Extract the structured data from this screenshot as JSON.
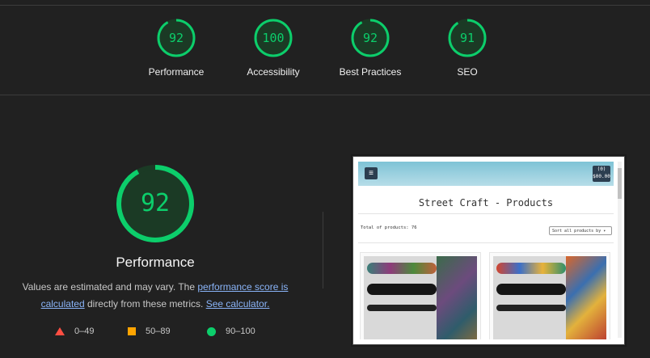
{
  "summary": [
    {
      "score": "92",
      "label": "Performance",
      "value": 92
    },
    {
      "score": "100",
      "label": "Accessibility",
      "value": 100
    },
    {
      "score": "92",
      "label": "Best Practices",
      "value": 92
    },
    {
      "score": "91",
      "label": "SEO",
      "value": 91
    }
  ],
  "performance": {
    "score": "92",
    "value": 92,
    "title": "Performance",
    "desc_prefix": "Values are estimated and may vary. The ",
    "link_score": "performance score is calculated",
    "desc_middle": " directly from these metrics. ",
    "link_calc": "See calculator."
  },
  "legend": [
    {
      "range": "0–49",
      "icon": "triangle-icon",
      "color": "#ff4e42"
    },
    {
      "range": "50–89",
      "icon": "square-icon",
      "color": "#ffa400"
    },
    {
      "range": "90–100",
      "icon": "circle-icon",
      "color": "#0cce6b"
    }
  ],
  "thumbnail": {
    "title": "Street Craft - Products",
    "total": "Total of products: 76",
    "sort": "Sort all products by",
    "cart_line1": "(0)",
    "cart_line2": "$00.00",
    "menu_icon": "hamburger-icon",
    "cart_icon": "cart-icon"
  },
  "colors": {
    "pass": "#0cce6b",
    "average": "#ffa400",
    "fail": "#ff4e42",
    "link": "#8ab4f8"
  }
}
